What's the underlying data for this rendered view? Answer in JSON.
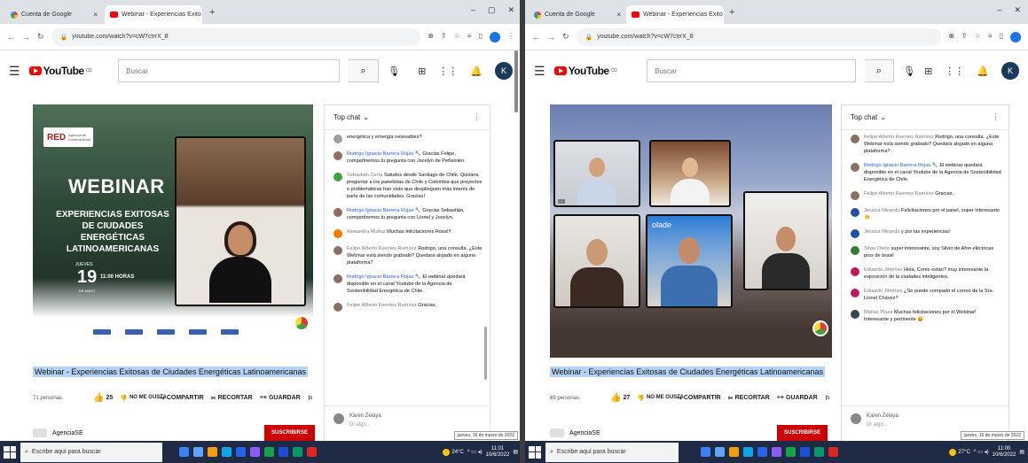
{
  "left": {
    "tabs": [
      {
        "label": "Cuenta de Google",
        "favicon": "google-icon"
      },
      {
        "label": "Webinar - Experiencias Exito",
        "favicon": "youtube-icon"
      }
    ],
    "url": "youtube.com/watch?v=cW7ctrrX_8",
    "search_placeholder": "Buscar",
    "video_title": "Webinar - Experiencias Exitosas de Ciudades Energéticas Latinoamericanas",
    "viewers": "71 personas",
    "likes": "25",
    "dislike_label": "NO ME GUSTA",
    "share_label": "COMPARTIR",
    "clip_label": "RECORTAR",
    "save_label": "GUARDAR",
    "channel_name": "AgenciaSE",
    "subscribe_label": "SUSCRIBIRSE",
    "avatar_letter": "K",
    "chat": {
      "title": "Top chat",
      "messages": [
        {
          "author": "",
          "text": "energética y emergía renovables?",
          "color": "#9e9e9e",
          "owner": false
        },
        {
          "author": "Rodrigo Ignacio Barrera Rojas",
          "text": "Gracias Felipe, compartiremos tu pregunta con Jocelyn de Peñalolén.",
          "color": "#8d6e63",
          "owner": true
        },
        {
          "author": "Sebastián Cerra",
          "text": "Saludos desde Santiago de Chile. Quisiera preguntar a los panelistas de Chile y Colombia que proyectos o problemáticas han visto que desplieguen más interés de parte de las comunidades. Gracias!",
          "color": "#43a047",
          "owner": false
        },
        {
          "author": "Rodrigo Ignacio Barrera Rojas",
          "text": "Gracias Sebastián, compartiremos tu pregunta con Lionel y Jocelyn.",
          "color": "#8d6e63",
          "owner": true
        },
        {
          "author": "Alexandra Muñoz",
          "text": "Muchas felicitaciones Rosa!!!",
          "color": "#f57c00",
          "owner": false
        },
        {
          "author": "Felipe Alberto Fuentes Ramírez",
          "text": "Rodrigo, una consulta. ¿Este Webinar está siendo grabado? Quedará alojado en alguna plataforma?",
          "color": "#8d6e63",
          "owner": false
        },
        {
          "author": "Rodrigo Ignacio Barrera Rojas",
          "text": "El webinar quedará disponible en el canal Youtube de la Agencia de Sostenibilidad Energética de Chile.",
          "color": "#8d6e63",
          "owner": true
        },
        {
          "author": "Felipe Alberto Fuentes Ramírez",
          "text": "Gracias.",
          "color": "#8d6e63",
          "owner": false
        }
      ],
      "input_name": "Karen Zelaya",
      "input_placeholder": "Di algo..."
    },
    "taskbar": {
      "search": "Escribe aquí para buscar",
      "weather": "24°C",
      "time": "11:01",
      "date": "10/6/2022",
      "popup": "jueves, 16 de marzo de 2022"
    }
  },
  "right": {
    "tabs": [
      {
        "label": "Cuenta de Google",
        "favicon": "google-icon"
      },
      {
        "label": "Webinar - Experiencias Exito",
        "favicon": "youtube-icon"
      }
    ],
    "url": "youtube.com/watch?v=cW7ctrrX_8",
    "search_placeholder": "Buscar",
    "video_title": "Webinar - Experiencias Exitosas de Ciudades Energéticas Latinoamericanas",
    "viewers": "69 personas",
    "likes": "27",
    "dislike_label": "NO ME GUSTA",
    "share_label": "COMPARTIR",
    "clip_label": "RECORTAR",
    "save_label": "GUARDAR",
    "channel_name": "AgenciaSE",
    "subscribe_label": "SUSCRIBIRSE",
    "avatar_letter": "K",
    "tile_word": "olade",
    "chat": {
      "title": "Top chat",
      "messages": [
        {
          "author": "Felipe Alberto Fuentes Ramírez",
          "text": "Rodrigo, una consulta. ¿Este Webinar está siendo grabado? Quedará alojado en alguna plataforma?",
          "color": "#8d6e63",
          "owner": false
        },
        {
          "author": "Rodrigo Ignacio Barrera Rojas",
          "text": "El webinar quedará disponible en el canal Youtube de la Agencia de Sostenibilidad Energética de Chile.",
          "color": "#8d6e63",
          "owner": true
        },
        {
          "author": "Felipe Alberto Fuentes Ramírez",
          "text": "Gracias.",
          "color": "#8d6e63",
          "owner": false
        },
        {
          "author": "Jessica Miranda",
          "text": "Felicitaciones por el panel, super interesante 👏",
          "color": "#1e4fa3",
          "owner": false
        },
        {
          "author": "Jessica Miranda",
          "text": "y por las experiencias!",
          "color": "#1e4fa3",
          "owner": false
        },
        {
          "author": "Silvio Otero",
          "text": "super interesante, soy Silvio de Afon eléctricas pros de brasil",
          "color": "#2e7d32",
          "owner": false
        },
        {
          "author": "Eduardo Jiménez",
          "text": "Hola, Como están? muy interesante la exposición de la ciudades inteligentes.",
          "color": "#c2185b",
          "owner": false
        },
        {
          "author": "Eduardo Jiménez",
          "text": "¿Se puede compartir el correo de la Sra. Lionel Chávez?",
          "color": "#c2185b",
          "owner": false
        },
        {
          "author": "Matías Plaza",
          "text": "Muchas felicitaciones por el Webinar! Interesante y pertinente 😀",
          "color": "#37474f",
          "owner": false
        }
      ],
      "input_name": "Karen Zelaya",
      "input_placeholder": "Di algo..."
    },
    "taskbar": {
      "search": "Escribe aquí para buscar",
      "weather": "27°C",
      "time": "11:00",
      "date": "10/6/2022",
      "popup": "jueves, 16 de marzo de 2022"
    }
  },
  "slide": {
    "logo": "RED",
    "logo_sub": "Agencia de Sostenibilidad",
    "heading": "WEBINAR",
    "subtitle": "EXPERIENCIAS EXITOSAS DE CIUDADES ENERGÉTICAS LATINOAMERICANAS",
    "day_label": "JUEVES",
    "day": "19",
    "time": "11:00 HORAS",
    "month": "DE MAYO"
  }
}
